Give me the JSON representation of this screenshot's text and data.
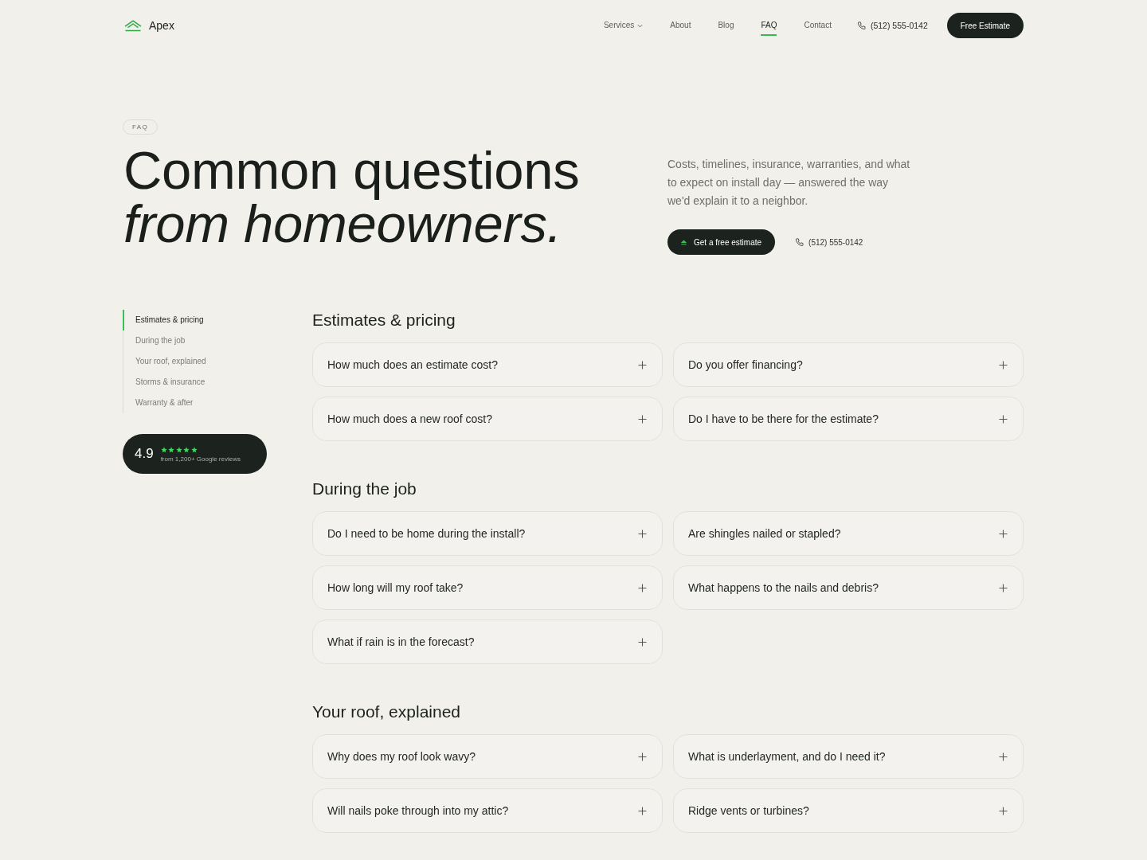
{
  "header": {
    "logo": "Apex",
    "nav": [
      {
        "label": "Services",
        "kind": "dropdown",
        "selected": false
      },
      {
        "label": "About",
        "kind": "link",
        "selected": false
      },
      {
        "label": "Blog",
        "kind": "link",
        "selected": false
      },
      {
        "label": "FAQ",
        "kind": "link",
        "selected": true
      },
      {
        "label": "Contact",
        "kind": "link",
        "selected": false
      }
    ],
    "phone": "(512) 555-0142",
    "cta": "Free Estimate"
  },
  "hero": {
    "badge": "FAQ",
    "title": "Common questions *from homeowners.*",
    "intro": "Costs, timelines, insurance, warranties, and what to expect on install day — answered the way we'd explain it to a neighbor.",
    "cta": "Get a free estimate",
    "phone": "(512) 555-0142"
  },
  "sidebar": {
    "items": [
      {
        "label": "Estimates & pricing",
        "selected": true
      },
      {
        "label": "During the job",
        "selected": false
      },
      {
        "label": "Your roof, explained",
        "selected": false
      },
      {
        "label": "Storms & insurance",
        "selected": false
      },
      {
        "label": "Warranty & after",
        "selected": false
      }
    ],
    "rating": {
      "score": "4.9",
      "stars": 5,
      "caption": "from 1,200+ Google reviews"
    }
  },
  "sections": [
    {
      "title": "Estimates & pricing",
      "questions": [
        {
          "text": "How much does an estimate cost?",
          "expanded": false
        },
        {
          "text": "Do you offer financing?",
          "expanded": false
        },
        {
          "text": "How much does a new roof cost?",
          "expanded": false
        },
        {
          "text": "Do I have to be there for the estimate?",
          "expanded": false
        }
      ]
    },
    {
      "title": "During the job",
      "questions": [
        {
          "text": "Do I need to be home during the install?",
          "expanded": false
        },
        {
          "text": "Are shingles nailed or stapled?",
          "expanded": false
        },
        {
          "text": "How long will my roof take?",
          "expanded": false
        },
        {
          "text": "What happens to the nails and debris?",
          "expanded": false
        },
        {
          "text": "What if rain is in the forecast?",
          "expanded": false
        }
      ]
    },
    {
      "title": "Your roof, explained",
      "questions": [
        {
          "text": "Why does my roof look wavy?",
          "expanded": false
        },
        {
          "text": "What is underlayment, and do I need it?",
          "expanded": false
        },
        {
          "text": "Will nails poke through into my attic?",
          "expanded": false
        },
        {
          "text": "Ridge vents or turbines?",
          "expanded": false
        }
      ]
    }
  ]
}
